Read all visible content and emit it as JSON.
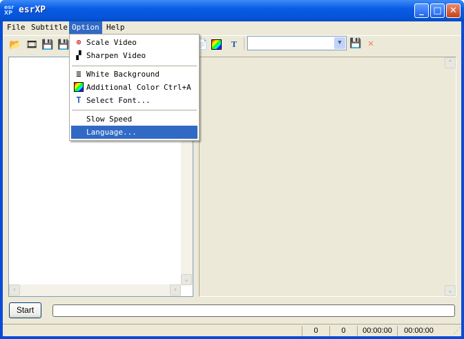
{
  "window": {
    "title": "esrXP",
    "icon_text": "esr XP"
  },
  "menubar": [
    "File",
    "Subtitle",
    "Option",
    "Help"
  ],
  "option_menu": {
    "items": [
      {
        "label": "Scale Video",
        "icon": "zoom-icon"
      },
      {
        "label": "Sharpen Video",
        "icon": "sharpen-icon"
      },
      {
        "label": "White Background",
        "icon": "document-icon"
      },
      {
        "label": "Additional Color",
        "shortcut": "Ctrl+A",
        "icon": "color-icon"
      },
      {
        "label": "Select Font...",
        "icon": "font-icon"
      },
      {
        "label": "Slow Speed"
      },
      {
        "label": "Language...",
        "highlighted": true
      }
    ]
  },
  "combo": {
    "value": ""
  },
  "start_label": "Start",
  "progress": 0,
  "status": {
    "c1": "0",
    "c2": "0",
    "t1": "00:00:00",
    "t2": "00:00:00"
  },
  "colors": {
    "accent": "#316ac5",
    "titlebar": "#0553d6",
    "face": "#ece9d8"
  }
}
